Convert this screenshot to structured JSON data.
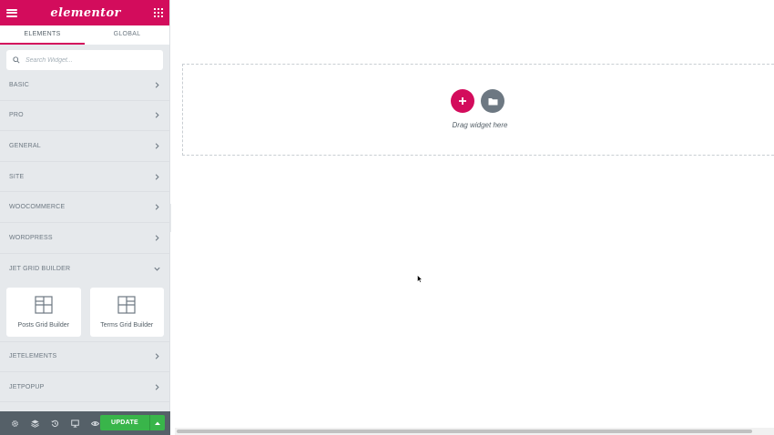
{
  "app": {
    "logo": "elementor",
    "colors": {
      "brand": "#d30c5c",
      "update": "#39b54a",
      "footer": "#556068",
      "sidebar": "#e6e9ec"
    }
  },
  "tabs": [
    {
      "label": "ELEMENTS",
      "active": true
    },
    {
      "label": "GLOBAL",
      "active": false
    }
  ],
  "search": {
    "placeholder": "Search Widget..."
  },
  "categories": [
    {
      "label": "BASIC"
    },
    {
      "label": "PRO"
    },
    {
      "label": "GENERAL"
    },
    {
      "label": "SITE"
    },
    {
      "label": "WOOCOMMERCE"
    },
    {
      "label": "WORDPRESS"
    },
    {
      "label": "JET GRID BUILDER",
      "expanded": true
    },
    {
      "label": "JETELEMENTS"
    },
    {
      "label": "JETPOPUP"
    }
  ],
  "widgets": [
    {
      "label": "Posts Grid Builder",
      "icon": "grid-builder-icon"
    },
    {
      "label": "Terms Grid Builder",
      "icon": "grid-builder-icon"
    }
  ],
  "footer": {
    "icons": [
      "settings-icon",
      "navigator-icon",
      "history-icon",
      "responsive-icon",
      "preview-icon"
    ],
    "update_label": "UPDATE"
  },
  "canvas": {
    "drop_text": "Drag widget here"
  }
}
